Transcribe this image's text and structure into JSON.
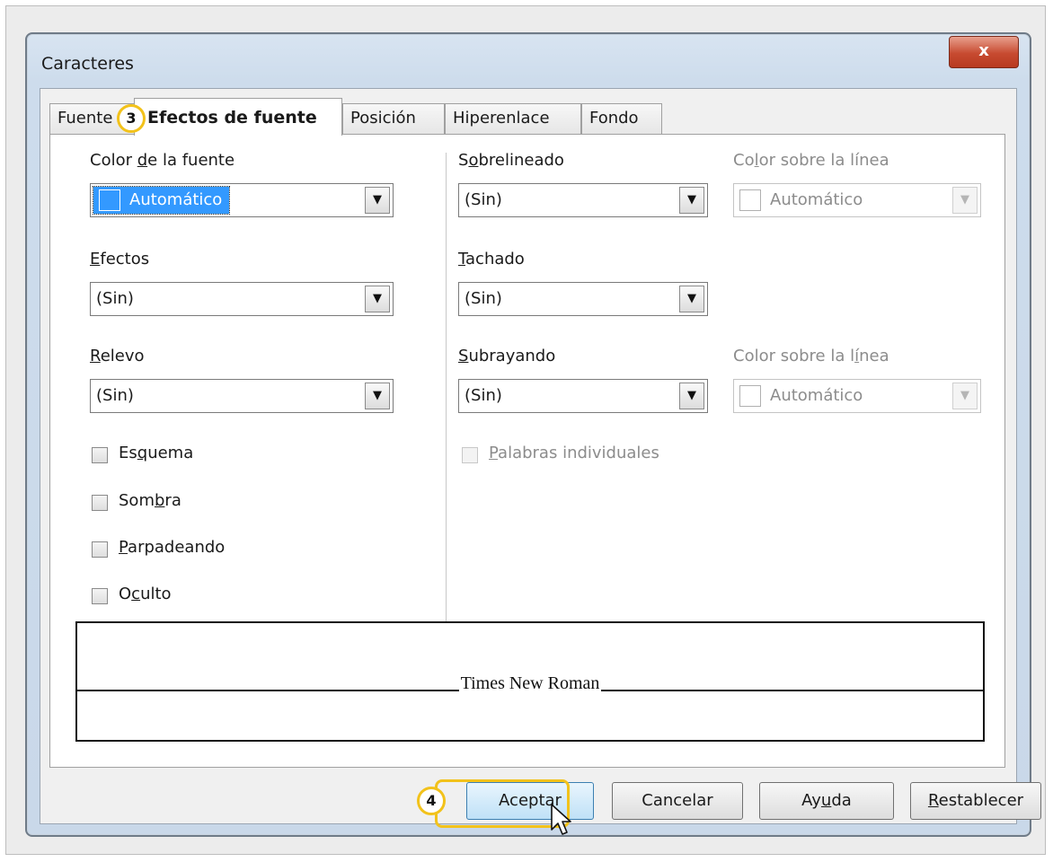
{
  "window": {
    "title": "Caracteres",
    "close_glyph": "x"
  },
  "tabs": [
    {
      "label": "Fuente",
      "active": false
    },
    {
      "label": "Efectos de fuente",
      "active": true
    },
    {
      "label": "Posición",
      "active": false
    },
    {
      "label": "Hiperenlace",
      "active": false
    },
    {
      "label": "Fondo",
      "active": false
    }
  ],
  "left": {
    "font_color": {
      "label_pre": "Color ",
      "label_ul": "d",
      "label_post": "e la fuente",
      "value": "Automático"
    },
    "effects": {
      "label_pre": "",
      "label_ul": "E",
      "label_post": "fectos",
      "value": "(Sin)"
    },
    "relief": {
      "label_pre": "",
      "label_ul": "R",
      "label_post": "elevo",
      "value": "(Sin)"
    },
    "checkboxes": [
      {
        "pre": "Es",
        "ul": "q",
        "post": "uema",
        "checked": false
      },
      {
        "pre": "Som",
        "ul": "b",
        "post": "ra",
        "checked": false
      },
      {
        "pre": "",
        "ul": "P",
        "post": "arpadeando",
        "checked": false
      },
      {
        "pre": "O",
        "ul": "c",
        "post": "ulto",
        "checked": false
      }
    ]
  },
  "right": {
    "overline": {
      "label_pre": "S",
      "label_ul": "o",
      "label_post": "brelineado",
      "value": "(Sin)"
    },
    "overline_color": {
      "label_pre": "Co",
      "label_ul": "l",
      "label_post": "or sobre la línea",
      "value": "Automático"
    },
    "strikethrough": {
      "label_pre": "",
      "label_ul": "T",
      "label_post": "achado",
      "value": "(Sin)"
    },
    "underline": {
      "label_pre": "",
      "label_ul": "S",
      "label_post": "ubrayando",
      "value": "(Sin)"
    },
    "underline_color": {
      "label_pre": "Color sobre la l",
      "label_ul": "í",
      "label_post": "nea",
      "value": "Automático"
    },
    "individual_words": {
      "pre": "",
      "ul": "P",
      "post": "alabras individuales",
      "checked": false
    }
  },
  "preview": {
    "text": "Times New Roman"
  },
  "buttons": {
    "ok": {
      "pre": "Aceptar",
      "ul": "",
      "post": ""
    },
    "cancel": {
      "pre": "Cancelar",
      "ul": "",
      "post": ""
    },
    "help": {
      "pre": "Ay",
      "ul": "u",
      "post": "da"
    },
    "reset": {
      "pre": "",
      "ul": "R",
      "post": "establecer"
    }
  },
  "annotations": {
    "step3": "3",
    "step4": "4"
  },
  "colors": {
    "accent_callout": "#f2c21b",
    "selection": "#3399ff",
    "close": "#c74a30"
  },
  "icons": {
    "dropdown": "chevron-down-icon",
    "close": "close-icon",
    "cursor": "mouse-pointer-icon"
  }
}
